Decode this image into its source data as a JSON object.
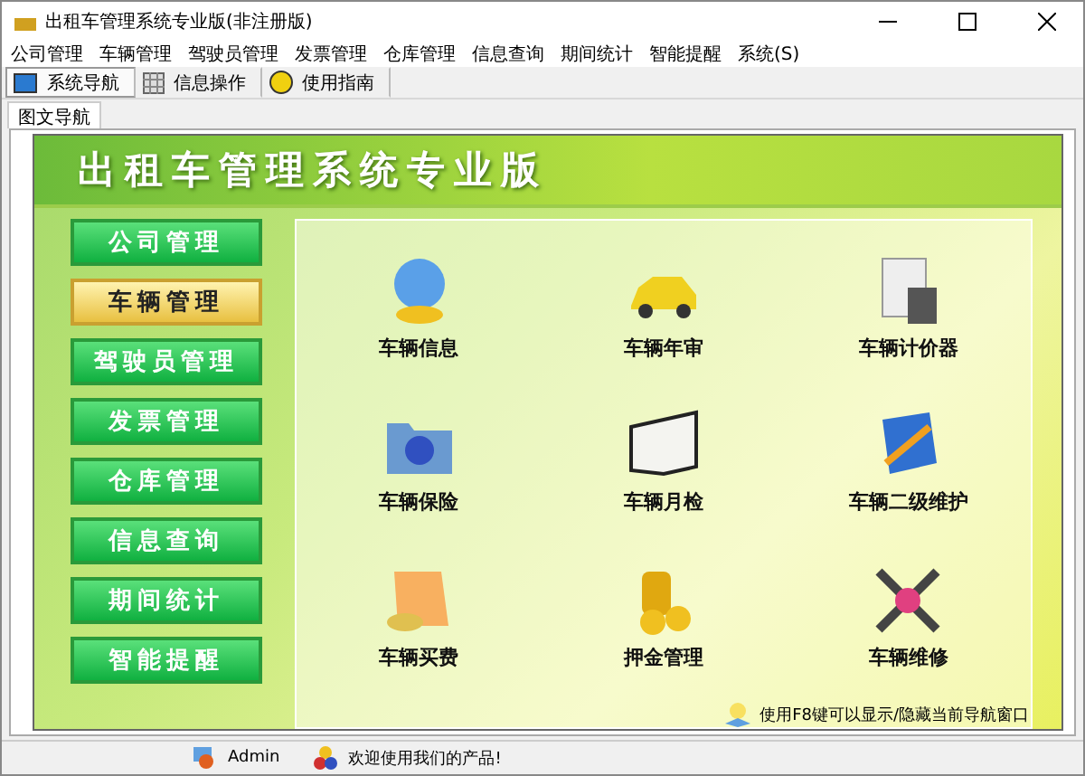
{
  "window": {
    "title": "出租车管理系统专业版(非注册版)"
  },
  "menu": [
    "公司管理",
    "车辆管理",
    "驾驶员管理",
    "发票管理",
    "仓库管理",
    "信息查询",
    "期间统计",
    "智能提醒",
    "系统(S)"
  ],
  "toolbar": [
    {
      "label": "系统导航",
      "kind": "monitor",
      "selected": true
    },
    {
      "label": "信息操作",
      "kind": "grid",
      "selected": false
    },
    {
      "label": "使用指南",
      "kind": "help",
      "selected": false
    }
  ],
  "tab": {
    "label": "图文导航"
  },
  "banner": {
    "title": "出租车管理系统专业版"
  },
  "nav": [
    {
      "label": "公司管理",
      "selected": false
    },
    {
      "label": "车辆管理",
      "selected": true
    },
    {
      "label": "驾驶员管理",
      "selected": false
    },
    {
      "label": "发票管理",
      "selected": false
    },
    {
      "label": "仓库管理",
      "selected": false
    },
    {
      "label": "信息查询",
      "selected": false
    },
    {
      "label": "期间统计",
      "selected": false
    },
    {
      "label": "智能提醒",
      "selected": false
    }
  ],
  "modules": [
    {
      "label": "车辆信息",
      "kind": "globe"
    },
    {
      "label": "车辆年审",
      "kind": "car"
    },
    {
      "label": "车辆计价器",
      "kind": "calculator"
    },
    {
      "label": "车辆保险",
      "kind": "folder"
    },
    {
      "label": "车辆月检",
      "kind": "binder"
    },
    {
      "label": "车辆二级维护",
      "kind": "book"
    },
    {
      "label": "车辆买费",
      "kind": "coinfolder"
    },
    {
      "label": "押金管理",
      "kind": "coins"
    },
    {
      "label": "车辆维修",
      "kind": "tools"
    }
  ],
  "hint": "使用F8键可以显示/隐藏当前导航窗口",
  "status": {
    "user": "Admin",
    "message": "欢迎使用我们的产品!"
  }
}
